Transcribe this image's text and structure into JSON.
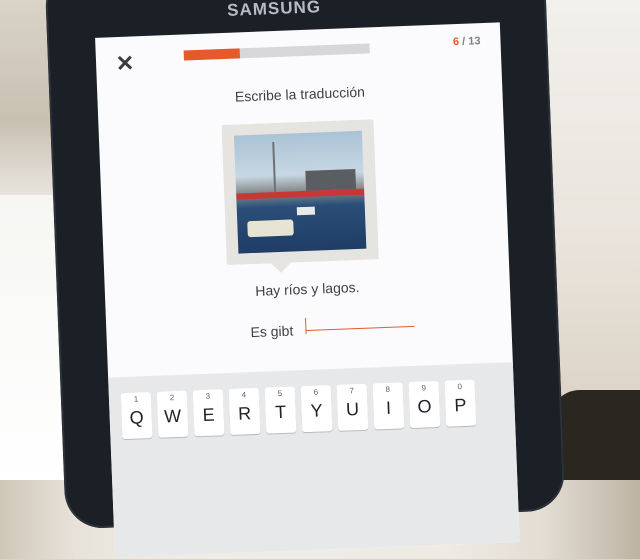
{
  "device": {
    "brand": "SAMSUNG"
  },
  "app": {
    "close_icon": "close-icon",
    "progress": {
      "current": 6,
      "total": 13,
      "fraction": 0.3,
      "separator": "/"
    },
    "instruction": "Escribe la traducción",
    "image_icon": "harbor-photo",
    "sentence": "Hay ríos y lagos.",
    "answer_prefix": "Es gibt",
    "answer_value": ""
  },
  "keyboard": {
    "keys": [
      {
        "num": "1",
        "letter": "Q"
      },
      {
        "num": "2",
        "letter": "W"
      },
      {
        "num": "3",
        "letter": "E"
      },
      {
        "num": "4",
        "letter": "R"
      },
      {
        "num": "5",
        "letter": "T"
      },
      {
        "num": "6",
        "letter": "Y"
      },
      {
        "num": "7",
        "letter": "U"
      },
      {
        "num": "8",
        "letter": "I"
      },
      {
        "num": "9",
        "letter": "O"
      },
      {
        "num": "0",
        "letter": "P"
      }
    ]
  },
  "colors": {
    "accent": "#e45a2c",
    "phone_body": "#1b1f26",
    "screen": "#fbfbfd"
  }
}
